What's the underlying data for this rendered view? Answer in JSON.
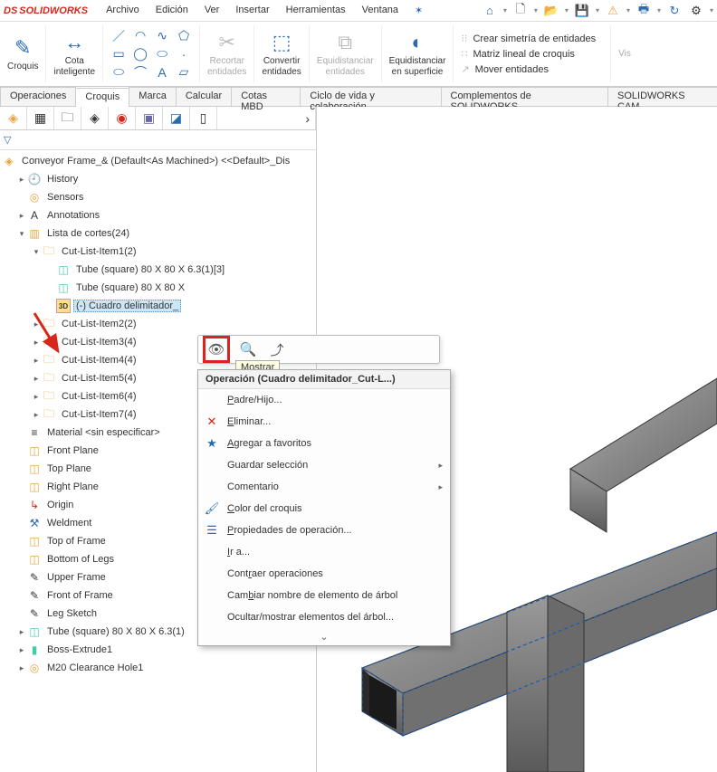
{
  "app": {
    "logo_prefix": "DS",
    "logo_text": "SOLIDWORKS"
  },
  "menubar": [
    "Archivo",
    "Edición",
    "Ver",
    "Insertar",
    "Herramientas",
    "Ventana"
  ],
  "qat": [
    "home",
    "new",
    "open",
    "save",
    "props",
    "print",
    "preview",
    "settings"
  ],
  "ribbon": {
    "croquis": {
      "label": "Croquis"
    },
    "cota": {
      "label": "Cota\ninteligente"
    },
    "recortar": {
      "label": "Recortar\nentidades"
    },
    "convertir": {
      "label": "Convertir\nentidades"
    },
    "equidistanciar": {
      "label": "Equidistanciar\nentidades"
    },
    "equisurf": {
      "label": "Equidistanciar\nen superficie"
    },
    "text_items": [
      "Crear simetría de entidades",
      "Matriz lineal de croquis",
      "Mover entidades"
    ],
    "vis": "Vis"
  },
  "tabs": [
    "Operaciones",
    "Croquis",
    "Marca",
    "Calcular",
    "Cotas MBD",
    "Ciclo de vida y colaboración",
    "Complementos de SOLIDWORKS",
    "SOLIDWORKS CAM"
  ],
  "root": "Conveyor Frame_& (Default<As Machined>) <<Default>_Dis",
  "tree": {
    "history": "History",
    "sensors": "Sensors",
    "annotations": "Annotations",
    "cutlist": "Lista de cortes(24)",
    "cl1": "Cut-List-Item1(2)",
    "tube1": "Tube (square) 80 X 80 X 6.3(1)[3]",
    "tube2": "Tube (square) 80 X 80 X",
    "box": "(-) Cuadro delimitador_",
    "cl2": "Cut-List-Item2(2)",
    "cl3": "Cut-List-Item3(4)",
    "cl4": "Cut-List-Item4(4)",
    "cl5": "Cut-List-Item5(4)",
    "cl6": "Cut-List-Item6(4)",
    "cl7": "Cut-List-Item7(4)",
    "material": "Material <sin especificar>",
    "fp": "Front Plane",
    "tp": "Top Plane",
    "rp": "Right Plane",
    "origin": "Origin",
    "weldment": "Weldment",
    "topframe": "Top of Frame",
    "bottomlegs": "Bottom of Legs",
    "upperframe": "Upper Frame",
    "frontframe": "Front of Frame",
    "legsketch": "Leg Sketch",
    "tube_feat": "Tube (square) 80 X 80 X 6.3(1)",
    "bossextrude": "Boss-Extrude1",
    "clearance": "M20 Clearance Hole1"
  },
  "tooltip": "Mostrar",
  "ctx": {
    "header": "Operación (Cuadro delimitador_Cut-L...)",
    "items": {
      "parent": "Padre/Hijo...",
      "delete": "Eliminar...",
      "fav": "Agregar a favoritos",
      "savesel": "Guardar selección",
      "comment": "Comentario",
      "color": "Color del croquis",
      "props": "Propiedades de operación...",
      "goto": "Ir a...",
      "collapse": "Contraer operaciones",
      "rename": "Cambiar nombre de elemento de árbol",
      "hide": "Ocultar/mostrar elementos del árbol..."
    }
  }
}
